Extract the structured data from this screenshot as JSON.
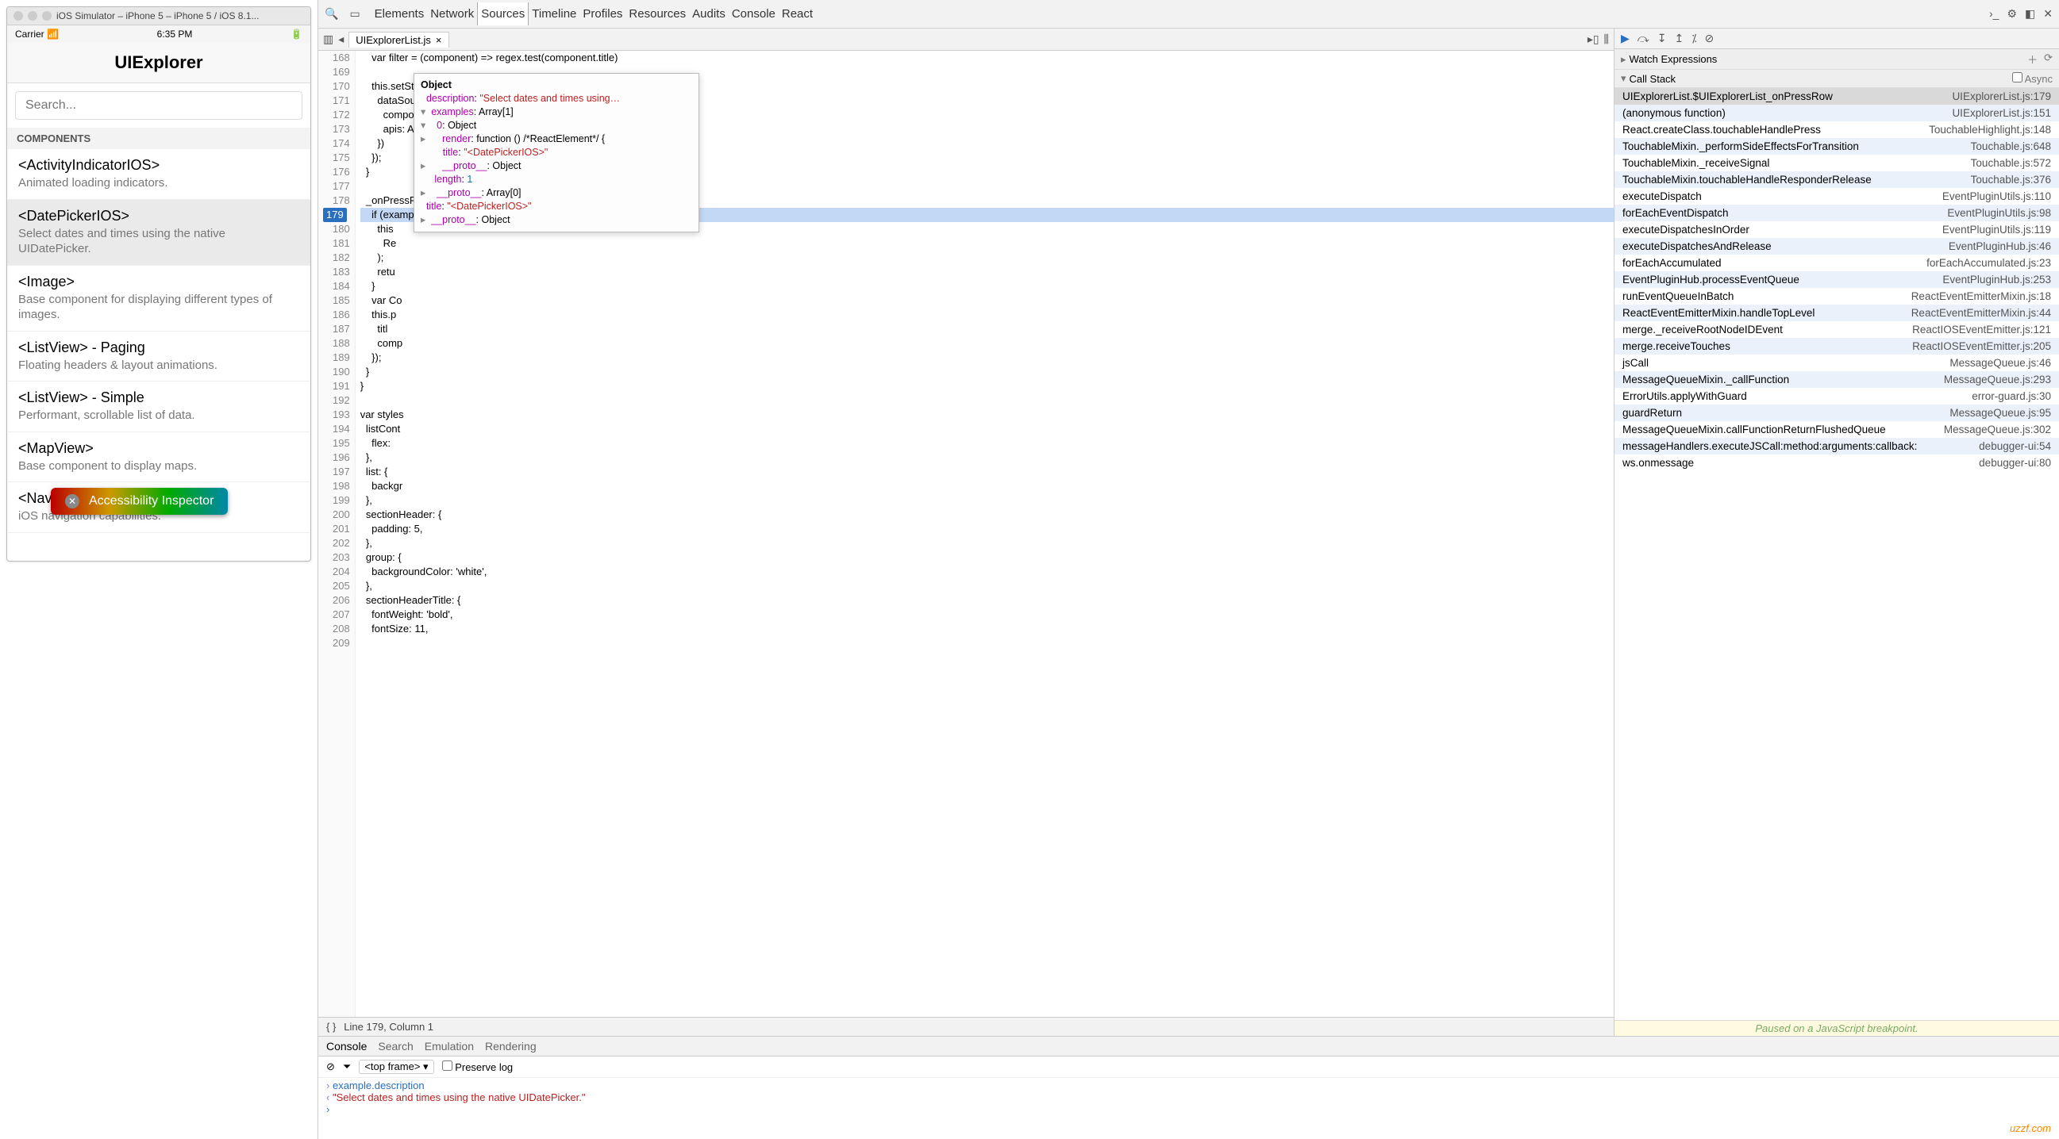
{
  "simulator": {
    "window_title": "iOS Simulator – iPhone 5 – iPhone 5 / iOS 8.1...",
    "carrier": "Carrier",
    "time": "6:35 PM",
    "app_title": "UIExplorer",
    "search_placeholder": "Search...",
    "section": "COMPONENTS",
    "rows": [
      {
        "title": "<ActivityIndicatorIOS>",
        "sub": "Animated loading indicators."
      },
      {
        "title": "<DatePickerIOS>",
        "sub": "Select dates and times using the native UIDatePicker."
      },
      {
        "title": "<Image>",
        "sub": "Base component for displaying different types of images."
      },
      {
        "title": "<ListView> - Paging",
        "sub": "Floating headers & layout animations."
      },
      {
        "title": "<ListView> - Simple",
        "sub": "Performant, scrollable list of data."
      },
      {
        "title": "<MapView>",
        "sub": "Base component to display maps."
      },
      {
        "title": "<NavigatorIOS>",
        "sub": "iOS navigation capabilities."
      }
    ],
    "a11y_label": "Accessibility Inspector"
  },
  "devtools": {
    "top_tabs": [
      "Elements",
      "Network",
      "Sources",
      "Timeline",
      "Profiles",
      "Resources",
      "Audits",
      "Console",
      "React"
    ],
    "active_top": "Sources",
    "file_tab": "UIExplorerList.js",
    "line_start": 168,
    "code_lines": [
      "    var filter = (component) => regex.test(component.title)",
      "",
      "    this.setState({",
      "      dataSource: ds.cloneWithRowsAndSections({",
      "        components: COMPONENTS.filter(filter),",
      "        apis: APIS.filter(filter),",
      "      })",
      "    });",
      "  }",
      "",
      "  _onPressRow(example) {",
      "    if (exampl  === ReactNavigatorExample) {",
      "      this",
      "        Re",
      "      );",
      "      retu",
      "    }",
      "    var Co",
      "    this.p",
      "      titl",
      "      comp",
      "    });",
      "  }",
      "}",
      "",
      "var styles",
      "  listCont",
      "    flex:",
      "  },",
      "  list: {",
      "    backgr",
      "  },",
      "  sectionHeader: {",
      "    padding: 5,",
      "  },",
      "  group: {",
      "    backgroundColor: 'white',",
      "  },",
      "  sectionHeaderTitle: {",
      "    fontWeight: 'bold',",
      "    fontSize: 11,",
      ""
    ],
    "breakpoint_line": 179,
    "status": "Line 179, Column 1",
    "tooltip": {
      "head": "Object",
      "description": "\"Select dates and times using…",
      "examples_len": "Array[1]",
      "idx0": "Object",
      "render": "function () /*ReactElement*/ {",
      "title0": "\"<DatePickerIOS>\"",
      "proto0": "Object",
      "length": 1,
      "protoArr": "Array[0]",
      "title": "\"<DatePickerIOS>\"",
      "proto": "Object"
    },
    "watch_label": "Watch Expressions",
    "callstack_label": "Call Stack",
    "async_label": "Async",
    "call_stack": [
      {
        "fn": "UIExplorerList.$UIExplorerList_onPressRow",
        "loc": "UIExplorerList.js:179"
      },
      {
        "fn": "(anonymous function)",
        "loc": "UIExplorerList.js:151"
      },
      {
        "fn": "React.createClass.touchableHandlePress",
        "loc": "TouchableHighlight.js:148"
      },
      {
        "fn": "TouchableMixin._performSideEffectsForTransition",
        "loc": "Touchable.js:648"
      },
      {
        "fn": "TouchableMixin._receiveSignal",
        "loc": "Touchable.js:572"
      },
      {
        "fn": "TouchableMixin.touchableHandleResponderRelease",
        "loc": "Touchable.js:376"
      },
      {
        "fn": "executeDispatch",
        "loc": "EventPluginUtils.js:110"
      },
      {
        "fn": "forEachEventDispatch",
        "loc": "EventPluginUtils.js:98"
      },
      {
        "fn": "executeDispatchesInOrder",
        "loc": "EventPluginUtils.js:119"
      },
      {
        "fn": "executeDispatchesAndRelease",
        "loc": "EventPluginHub.js:46"
      },
      {
        "fn": "forEachAccumulated",
        "loc": "forEachAccumulated.js:23"
      },
      {
        "fn": "EventPluginHub.processEventQueue",
        "loc": "EventPluginHub.js:253"
      },
      {
        "fn": "runEventQueueInBatch",
        "loc": "ReactEventEmitterMixin.js:18"
      },
      {
        "fn": "ReactEventEmitterMixin.handleTopLevel",
        "loc": "ReactEventEmitterMixin.js:44"
      },
      {
        "fn": "merge._receiveRootNodeIDEvent",
        "loc": "ReactIOSEventEmitter.js:121"
      },
      {
        "fn": "merge.receiveTouches",
        "loc": "ReactIOSEventEmitter.js:205"
      },
      {
        "fn": "jsCall",
        "loc": "MessageQueue.js:46"
      },
      {
        "fn": "MessageQueueMixin._callFunction",
        "loc": "MessageQueue.js:293"
      },
      {
        "fn": "ErrorUtils.applyWithGuard",
        "loc": "error-guard.js:30"
      },
      {
        "fn": "guardReturn",
        "loc": "MessageQueue.js:95"
      },
      {
        "fn": "MessageQueueMixin.callFunctionReturnFlushedQueue",
        "loc": "MessageQueue.js:302"
      },
      {
        "fn": "messageHandlers.executeJSCall:method:arguments:callback:",
        "loc": "debugger-ui:54"
      },
      {
        "fn": "ws.onmessage",
        "loc": "debugger-ui:80"
      }
    ],
    "paused_msg": "Paused on a JavaScript breakpoint.",
    "drawer_tabs": [
      "Console",
      "Search",
      "Emulation",
      "Rendering"
    ],
    "drawer_active": "Console",
    "frame_sel": "<top frame>",
    "preserve_log": "Preserve log",
    "console": [
      {
        "t": "in",
        "v": "example.description"
      },
      {
        "t": "out",
        "v": "\"Select dates and times using the native UIDatePicker.\""
      }
    ]
  },
  "watermark": "uzzf.com"
}
